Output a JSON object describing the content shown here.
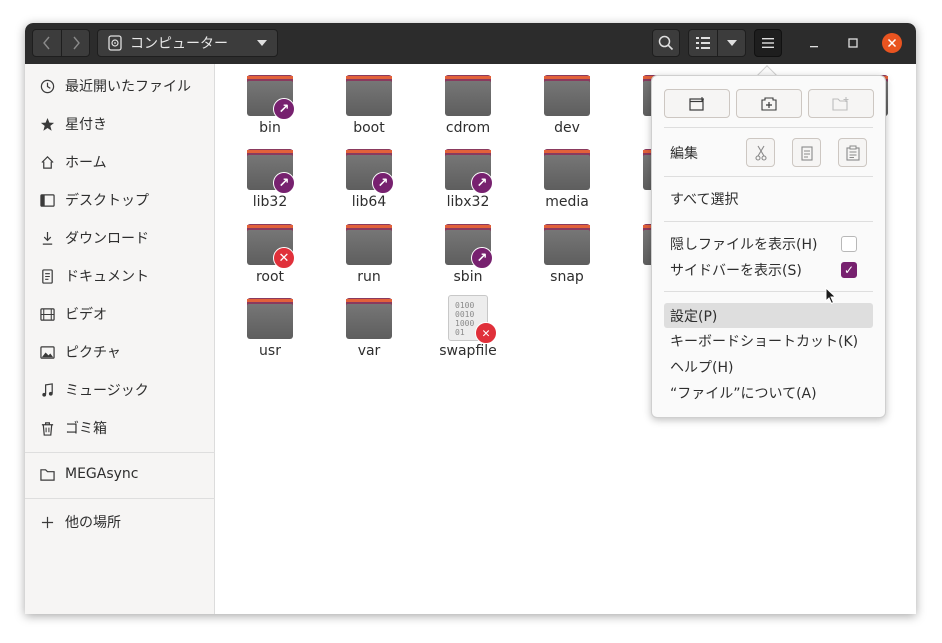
{
  "window": {
    "location_label": "コンピューター",
    "header_buttons": {
      "back": "back-icon",
      "forward": "forward-icon",
      "search": "search-icon",
      "view": "list-view-icon",
      "view_menu": "chevron-down-icon",
      "menu": "hamburger-icon"
    },
    "window_controls": [
      "minimize",
      "maximize",
      "close"
    ]
  },
  "sidebar": {
    "items": [
      {
        "label": "最近開いたファイル",
        "icon": "clock-icon"
      },
      {
        "label": "星付き",
        "icon": "star-icon"
      },
      {
        "label": "ホーム",
        "icon": "home-icon"
      },
      {
        "label": "デスクトップ",
        "icon": "desktop-icon"
      },
      {
        "label": "ダウンロード",
        "icon": "download-icon"
      },
      {
        "label": "ドキュメント",
        "icon": "document-icon"
      },
      {
        "label": "ビデオ",
        "icon": "video-icon"
      },
      {
        "label": "ピクチャ",
        "icon": "picture-icon"
      },
      {
        "label": "ミュージック",
        "icon": "music-icon"
      },
      {
        "label": "ゴミ箱",
        "icon": "trash-icon"
      }
    ],
    "mounts": [
      {
        "label": "MEGAsync",
        "icon": "folder-icon"
      }
    ],
    "other": {
      "label": "他の場所",
      "icon": "plus-icon"
    }
  },
  "files": [
    {
      "name": "bin",
      "emblem": "link"
    },
    {
      "name": "boot",
      "emblem": ""
    },
    {
      "name": "cdrom",
      "emblem": ""
    },
    {
      "name": "dev",
      "emblem": ""
    },
    {
      "name": "lib32",
      "emblem": "link"
    },
    {
      "name": "lib64",
      "emblem": "link"
    },
    {
      "name": "libx32",
      "emblem": "link"
    },
    {
      "name": "media",
      "emblem": ""
    },
    {
      "name": "root",
      "emblem": "no-access"
    },
    {
      "name": "run",
      "emblem": ""
    },
    {
      "name": "sbin",
      "emblem": "link"
    },
    {
      "name": "snap",
      "emblem": ""
    },
    {
      "name": "usr",
      "emblem": ""
    },
    {
      "name": "var",
      "emblem": ""
    },
    {
      "name": "swapfile",
      "emblem": "no-access",
      "kind": "binary"
    }
  ],
  "swap_text": [
    "0100",
    "0010",
    "1000",
    "01"
  ],
  "menu": {
    "top_buttons": [
      "new-window-icon",
      "new-tab-icon",
      "new-folder-icon"
    ],
    "edit_label": "編集",
    "edit_buttons": [
      "cut-icon",
      "copy-icon",
      "paste-icon"
    ],
    "select_all": "すべて選択",
    "show_hidden": "隠しファイルを表示(H)",
    "show_hidden_checked": false,
    "show_sidebar": "サイドバーを表示(S)",
    "show_sidebar_checked": true,
    "preferences": "設定(P)",
    "shortcuts": "キーボードショートカット(K)",
    "help": "ヘルプ(H)",
    "about": "“ファイル”について(A)"
  },
  "colors": {
    "headerbar": "#2c2c2c",
    "accent_orange": "#e95420",
    "aubergine": "#77216f",
    "folder_gray": "#6a6a6a"
  }
}
